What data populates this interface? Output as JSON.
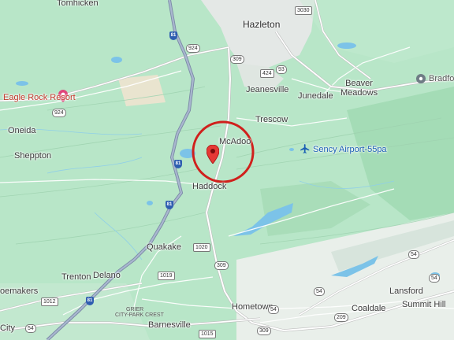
{
  "map": {
    "circle_color": "#d0201c",
    "pin_color": "#e53935",
    "places": {
      "tomhicken": "Tomhicken",
      "hazleton": "Hazleton",
      "jeanesville": "Jeanesville",
      "junedale": "Junedale",
      "beaver_meadows": "Beaver\nMeadows",
      "bradford": "Bradford",
      "oneida": "Oneida",
      "sheppton": "Sheppton",
      "trescow": "Trescow",
      "mcadoo": "McAdoo",
      "haddock": "Haddock",
      "quakake": "Quakake",
      "trenton": "Trenton",
      "delano": "Delano",
      "shoemakers": "oemakers",
      "hometown": "Hometown",
      "coaldale": "Coaldale",
      "lansford": "Lansford",
      "summit_hill": "Summit Hill",
      "barnesville": "Barnesville",
      "city": "City",
      "grier_city": "GRIER",
      "park_crest": "CITY-PARK CREST"
    },
    "pois": {
      "eagle_rock": "Eagle Rock Resort",
      "airport": "Sency Airport-55pa"
    },
    "routes": {
      "r3030": "3030",
      "r81a": "81",
      "r924a": "924",
      "r309a": "309",
      "r93": "93",
      "r424": "424",
      "r924b": "924",
      "r81b": "81",
      "r81c": "81",
      "r1020": "1020",
      "r309b": "309",
      "r1019": "1019",
      "r1012": "1012",
      "r81d": "81",
      "r54a": "54",
      "r54b": "54",
      "r54c": "54",
      "r54d": "54",
      "r209": "209",
      "r1015": "1015",
      "r309c": "309",
      "r54e": "54"
    },
    "icons": {
      "eagle_rock": "resort-pin-icon",
      "airport": "airplane-icon",
      "bradford": "place-pin-icon",
      "mcadoo": "location-pin-icon"
    }
  }
}
